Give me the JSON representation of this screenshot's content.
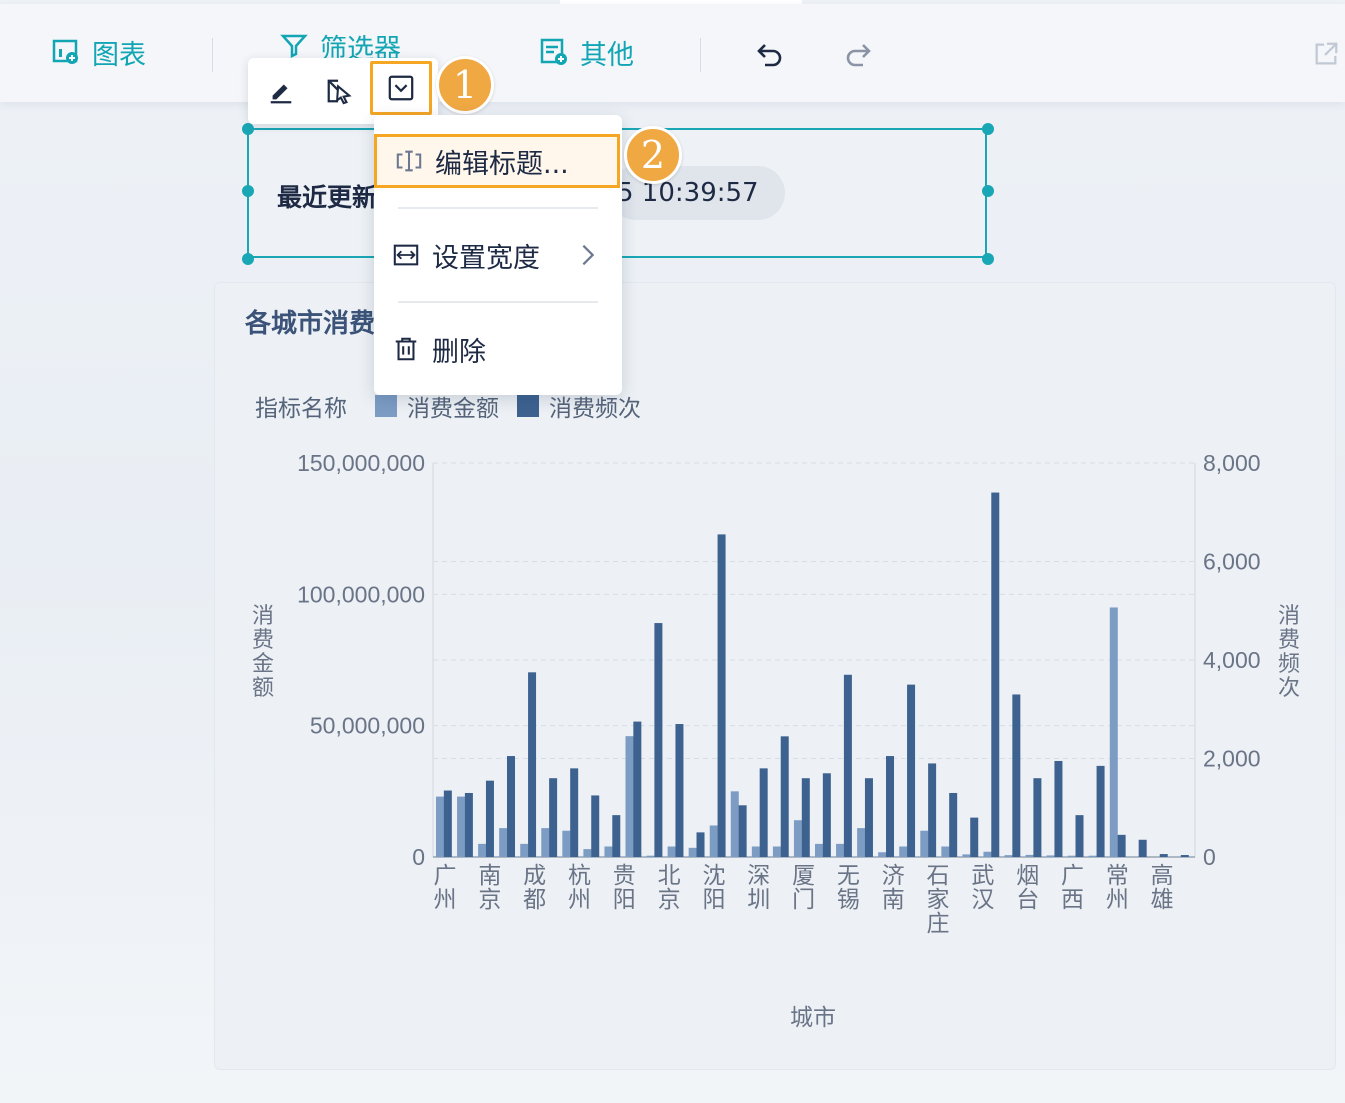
{
  "toolbar": {
    "chart_label": "图表",
    "filter_label": "筛选器",
    "other_label": "其他"
  },
  "badges": {
    "step1": "1",
    "step2": "2"
  },
  "widget": {
    "label": "最近更新",
    "time": "5 10:39:57"
  },
  "menu": {
    "edit_title": "编辑标题...",
    "set_width": "设置宽度",
    "delete": "删除"
  },
  "colors": {
    "accent": "#1aa7b5",
    "highlight": "#f5a623",
    "series_amount": "#7c9cc4",
    "series_freq": "#3d6290"
  },
  "chart_data": {
    "type": "bar",
    "title": "各城市消费",
    "legend_title": "指标名称",
    "xlabel": "城市",
    "ylabel_left": "消费金额",
    "ylabel_right": "消费频次",
    "left_ticks": [
      "150,000,000",
      "100,000,000",
      "50,000,000",
      "0"
    ],
    "right_ticks": [
      "8,000",
      "6,000",
      "4,000",
      "2,000",
      "0"
    ],
    "ylim_left": [
      0,
      150000000
    ],
    "ylim_right": [
      0,
      8000
    ],
    "grid": true,
    "categories": [
      "广州",
      "南京",
      "成都",
      "杭州",
      "贵阳",
      "北京",
      "沈阳",
      "深圳",
      "厦门",
      "无锡",
      "济南",
      "石家庄",
      "武汉",
      "烟台",
      "广西",
      "常州",
      "高雄"
    ],
    "series": [
      {
        "name": "消费金额",
        "axis": "left",
        "values": [
          24000000,
          9000000,
          12000000,
          31000000,
          16000000,
          6000000,
          11000000,
          4000000,
          58000000,
          4000000,
          36000000,
          13000000,
          4000000,
          5000000,
          7000000,
          5000000,
          8000000,
          0,
          1500000,
          1000000,
          500000
        ]
      },
      {
        "name": "消费频次",
        "axis": "right",
        "values": [
          1200,
          1350,
          1500,
          1700,
          2200,
          3700,
          1600,
          1780,
          1300,
          850,
          2750,
          4750,
          500,
          6550,
          1050,
          1800,
          2400,
          3600,
          2900,
          1600,
          2050,
          3900,
          1450,
          800,
          7400,
          3300,
          1600,
          850,
          1850,
          400,
          350,
          60
        ]
      }
    ],
    "bars_full": {
      "amount": [
        23000000,
        23000000,
        5000000,
        11000000,
        5000000,
        11000000,
        10000000,
        3000000,
        4000000,
        46000000,
        500000,
        4000000,
        3500000,
        12000000,
        25000000,
        4000000,
        4000000,
        14000000,
        5000000,
        5000000,
        11000000,
        1800000,
        4000000,
        10000000,
        4000000,
        1000000,
        2000000,
        700000,
        800000,
        600000,
        500000,
        500000,
        95000000
      ],
      "freq": [
        1350,
        1300,
        1550,
        2050,
        3750,
        1600,
        1800,
        1250,
        850,
        2750,
        4750,
        2700,
        500,
        6550,
        1050,
        1800,
        2450,
        1600,
        1700,
        3700,
        1600,
        2050,
        3500,
        1900,
        1300,
        800,
        7400,
        3300,
        1600,
        1950,
        850,
        1850,
        450,
        350,
        60,
        40
      ]
    }
  }
}
